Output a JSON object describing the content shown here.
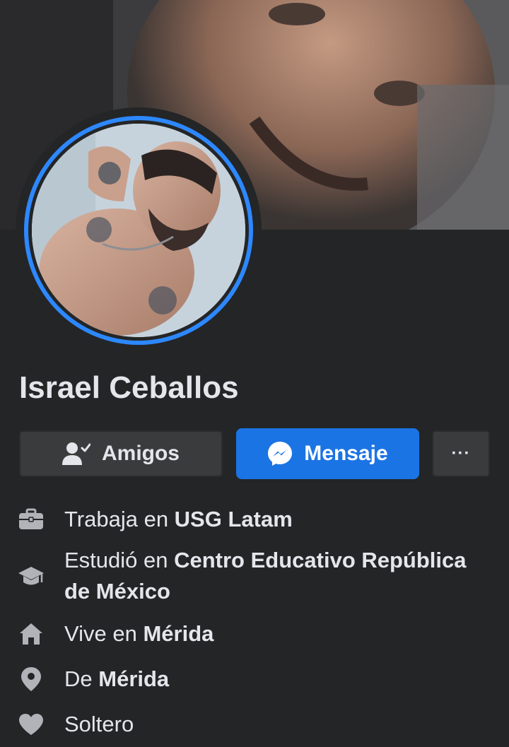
{
  "profile": {
    "name": "Israel Ceballos"
  },
  "actions": {
    "friends_label": "Amigos",
    "message_label": "Mensaje",
    "more_label": "···"
  },
  "details": [
    {
      "icon": "briefcase-icon",
      "prefix": "Trabaja en ",
      "value": "USG Latam"
    },
    {
      "icon": "graduation-cap-icon",
      "prefix": "Estudió en ",
      "value": "Centro Educativo República de México"
    },
    {
      "icon": "home-icon",
      "prefix": "Vive en ",
      "value": "Mérida"
    },
    {
      "icon": "location-pin-icon",
      "prefix": "De ",
      "value": "Mérida"
    },
    {
      "icon": "heart-icon",
      "prefix": "Soltero",
      "value": ""
    }
  ],
  "colors": {
    "background": "#242526",
    "accent": "#1b74e4",
    "ring": "#2d88ff",
    "button_gray": "#3a3b3c",
    "text": "#e4e6eb"
  }
}
